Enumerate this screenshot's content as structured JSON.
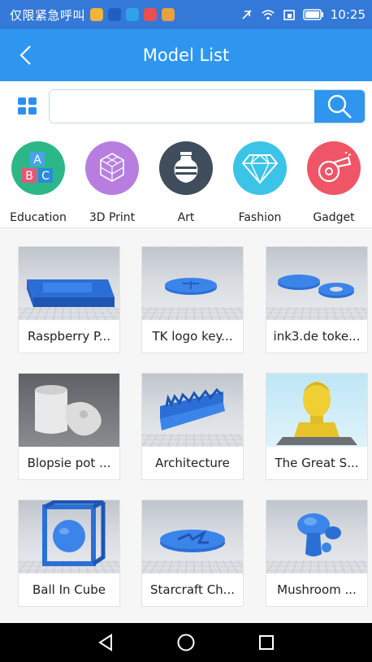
{
  "status_bar": {
    "carrier": "仅限紧急呼叫",
    "time": "10:25",
    "notification_icons": [
      "#f4b33a",
      "#1f5fc4",
      "#30a2e8",
      "#e85050",
      "#e8a040"
    ]
  },
  "header": {
    "title": "Model List",
    "background": "#2f96f0"
  },
  "search": {
    "placeholder": "",
    "value": ""
  },
  "categories": [
    {
      "label": "Education",
      "color": "#2bb886",
      "icon": "abc-blocks-icon"
    },
    {
      "label": "3D Print",
      "color": "#b77ee0",
      "icon": "3d-print-icon"
    },
    {
      "label": "Art",
      "color": "#3f4d5c",
      "icon": "vase-icon"
    },
    {
      "label": "Fashion",
      "color": "#3cc4e8",
      "icon": "diamond-icon"
    },
    {
      "label": "Gadget",
      "color": "#ef5566",
      "icon": "whistle-icon"
    }
  ],
  "models": [
    {
      "label": "Raspberry P..."
    },
    {
      "label": "TK logo key..."
    },
    {
      "label": "ink3.de toke..."
    },
    {
      "label": "Blopsie pot ..."
    },
    {
      "label": "Architecture"
    },
    {
      "label": "The Great S..."
    },
    {
      "label": "Ball In Cube"
    },
    {
      "label": "Starcraft Ch..."
    },
    {
      "label": "Mushroom ..."
    }
  ]
}
